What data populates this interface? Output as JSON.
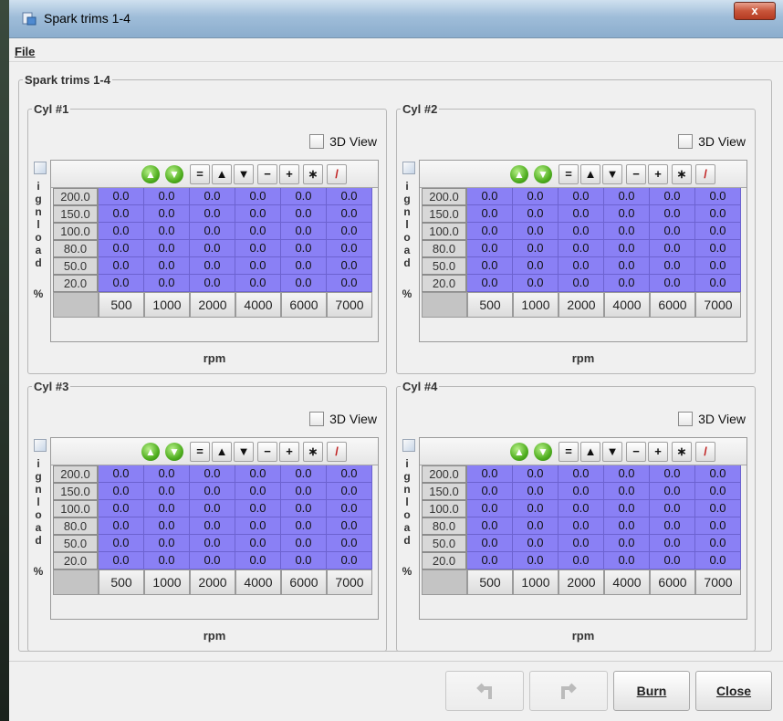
{
  "window": {
    "title": "Spark trims 1-4",
    "close_glyph": "x"
  },
  "menu": {
    "file": "File"
  },
  "outer_title": "Spark trims 1-4",
  "view3d_label": "3D View",
  "side_letters": [
    "i",
    "g",
    "n",
    "l",
    "o",
    "a",
    "d",
    "",
    "",
    "%"
  ],
  "x_axis_label": "rpm",
  "toolbar_icons": [
    "increase-icon",
    "decrease-icon",
    "equals-icon",
    "up-arrow-icon",
    "down-arrow-icon",
    "minus-icon",
    "plus-icon",
    "multiply-icon",
    "pen-icon"
  ],
  "toolbar_glyphs": [
    "▲",
    "▼",
    "=",
    "▲",
    "▼",
    "−",
    "+",
    "∗",
    "/"
  ],
  "y_labels": [
    "200.0",
    "150.0",
    "100.0",
    "80.0",
    "50.0",
    "20.0"
  ],
  "x_labels": [
    "500",
    "1000",
    "2000",
    "4000",
    "6000",
    "7000"
  ],
  "tables": [
    {
      "title": "Cyl #1",
      "values": [
        [
          "0.0",
          "0.0",
          "0.0",
          "0.0",
          "0.0",
          "0.0"
        ],
        [
          "0.0",
          "0.0",
          "0.0",
          "0.0",
          "0.0",
          "0.0"
        ],
        [
          "0.0",
          "0.0",
          "0.0",
          "0.0",
          "0.0",
          "0.0"
        ],
        [
          "0.0",
          "0.0",
          "0.0",
          "0.0",
          "0.0",
          "0.0"
        ],
        [
          "0.0",
          "0.0",
          "0.0",
          "0.0",
          "0.0",
          "0.0"
        ],
        [
          "0.0",
          "0.0",
          "0.0",
          "0.0",
          "0.0",
          "0.0"
        ]
      ]
    },
    {
      "title": "Cyl #2",
      "values": [
        [
          "0.0",
          "0.0",
          "0.0",
          "0.0",
          "0.0",
          "0.0"
        ],
        [
          "0.0",
          "0.0",
          "0.0",
          "0.0",
          "0.0",
          "0.0"
        ],
        [
          "0.0",
          "0.0",
          "0.0",
          "0.0",
          "0.0",
          "0.0"
        ],
        [
          "0.0",
          "0.0",
          "0.0",
          "0.0",
          "0.0",
          "0.0"
        ],
        [
          "0.0",
          "0.0",
          "0.0",
          "0.0",
          "0.0",
          "0.0"
        ],
        [
          "0.0",
          "0.0",
          "0.0",
          "0.0",
          "0.0",
          "0.0"
        ]
      ]
    },
    {
      "title": "Cyl #3",
      "values": [
        [
          "0.0",
          "0.0",
          "0.0",
          "0.0",
          "0.0",
          "0.0"
        ],
        [
          "0.0",
          "0.0",
          "0.0",
          "0.0",
          "0.0",
          "0.0"
        ],
        [
          "0.0",
          "0.0",
          "0.0",
          "0.0",
          "0.0",
          "0.0"
        ],
        [
          "0.0",
          "0.0",
          "0.0",
          "0.0",
          "0.0",
          "0.0"
        ],
        [
          "0.0",
          "0.0",
          "0.0",
          "0.0",
          "0.0",
          "0.0"
        ],
        [
          "0.0",
          "0.0",
          "0.0",
          "0.0",
          "0.0",
          "0.0"
        ]
      ]
    },
    {
      "title": "Cyl #4",
      "values": [
        [
          "0.0",
          "0.0",
          "0.0",
          "0.0",
          "0.0",
          "0.0"
        ],
        [
          "0.0",
          "0.0",
          "0.0",
          "0.0",
          "0.0",
          "0.0"
        ],
        [
          "0.0",
          "0.0",
          "0.0",
          "0.0",
          "0.0",
          "0.0"
        ],
        [
          "0.0",
          "0.0",
          "0.0",
          "0.0",
          "0.0",
          "0.0"
        ],
        [
          "0.0",
          "0.0",
          "0.0",
          "0.0",
          "0.0",
          "0.0"
        ],
        [
          "0.0",
          "0.0",
          "0.0",
          "0.0",
          "0.0",
          "0.0"
        ]
      ]
    }
  ],
  "buttons": {
    "undo_icon": "undo-icon",
    "redo_icon": "redo-icon",
    "burn": "Burn",
    "close": "Close"
  },
  "colors": {
    "cell_fill": "#8a80f5",
    "titlebar": "#9fbdd9"
  }
}
